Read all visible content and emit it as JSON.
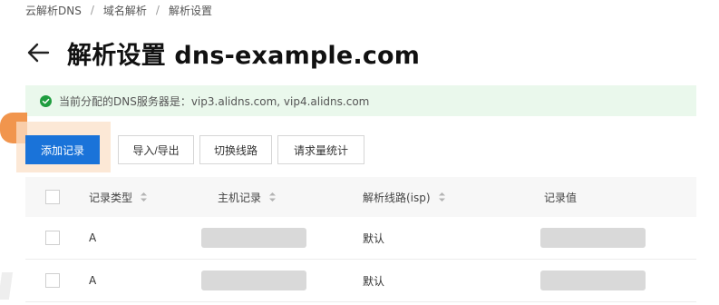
{
  "breadcrumb": [
    "云解析DNS",
    "域名解析",
    "解析设置"
  ],
  "page": {
    "title": "解析设置 dns-example.com"
  },
  "notice": {
    "text": "当前分配的DNS服务器是：vip3.alidns.com, vip4.alidns.com",
    "color": "#eaf8ec"
  },
  "toolbar": {
    "add": "添加记录",
    "import_export": "导入/导出",
    "switch_line": "切换线路",
    "request_stats": "请求量统计"
  },
  "table": {
    "headers": {
      "type": "记录类型",
      "host": "主机记录",
      "line": "解析线路(isp)",
      "value": "记录值"
    },
    "rows": [
      {
        "type": "A",
        "line": "默认"
      },
      {
        "type": "A",
        "line": "默认"
      }
    ]
  },
  "colors": {
    "primary": "#1a73d9",
    "success": "#1f9d3f"
  }
}
